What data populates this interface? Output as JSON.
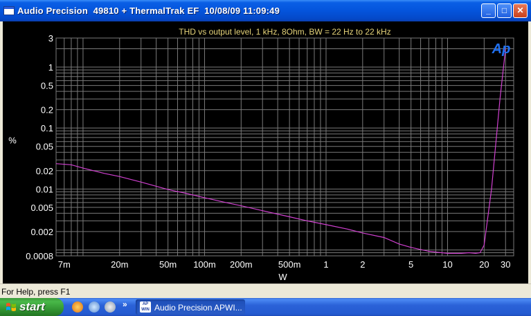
{
  "window": {
    "title": "Audio Precision  49810 + ThermalTrak EF  10/08/09 11:09:49",
    "minimize_glyph": "_",
    "maximize_glyph": "□",
    "close_glyph": "✕"
  },
  "status_bar": {
    "text": "For Help, press F1"
  },
  "taskbar": {
    "start_label": "start",
    "task_label": "Audio Precision APWI...",
    "task_icon_text": "AP WIN",
    "chevron": "»"
  },
  "colors": {
    "title_text": "#e6d47a",
    "trace": "#d040d0",
    "grid": "#7a7a7a",
    "tick_text": "#ffffff",
    "logo": "#2070f0"
  },
  "chart_data": {
    "type": "line",
    "title": "THD vs output level, 1 kHz, 8Ohm, BW = 22 Hz to 22 kHz",
    "xlabel": "W",
    "ylabel": "%",
    "x_scale": "log",
    "y_scale": "log",
    "xlim": [
      0.006,
      35
    ],
    "ylim": [
      0.0008,
      3
    ],
    "grid": true,
    "logo": "Ap",
    "x_ticks": [
      {
        "v": 0.007,
        "label": "7m"
      },
      {
        "v": 0.02,
        "label": "20m"
      },
      {
        "v": 0.05,
        "label": "50m"
      },
      {
        "v": 0.1,
        "label": "100m"
      },
      {
        "v": 0.2,
        "label": "200m"
      },
      {
        "v": 0.5,
        "label": "500m"
      },
      {
        "v": 1,
        "label": "1"
      },
      {
        "v": 2,
        "label": "2"
      },
      {
        "v": 5,
        "label": "5"
      },
      {
        "v": 10,
        "label": "10"
      },
      {
        "v": 20,
        "label": "20"
      },
      {
        "v": 30,
        "label": "30"
      }
    ],
    "y_ticks": [
      {
        "v": 3,
        "label": "3"
      },
      {
        "v": 1,
        "label": "1"
      },
      {
        "v": 0.5,
        "label": "0.5"
      },
      {
        "v": 0.2,
        "label": "0.2"
      },
      {
        "v": 0.1,
        "label": "0.1"
      },
      {
        "v": 0.05,
        "label": "0.05"
      },
      {
        "v": 0.02,
        "label": "0.02"
      },
      {
        "v": 0.01,
        "label": "0.01"
      },
      {
        "v": 0.005,
        "label": "0.005"
      },
      {
        "v": 0.002,
        "label": "0.002"
      },
      {
        "v": 0.0008,
        "label": "0.0008"
      }
    ],
    "series": [
      {
        "x": [
          0.006,
          0.008,
          0.01,
          0.015,
          0.02,
          0.03,
          0.05,
          0.07,
          0.1,
          0.15,
          0.2,
          0.3,
          0.5,
          0.7,
          1,
          1.5,
          2,
          3,
          4,
          5,
          7,
          10,
          13,
          15,
          17,
          18.5,
          20,
          23,
          27,
          30
        ],
        "y": [
          0.026,
          0.025,
          0.022,
          0.018,
          0.016,
          0.013,
          0.0098,
          0.0085,
          0.0072,
          0.006,
          0.0053,
          0.0044,
          0.0035,
          0.003,
          0.0026,
          0.0022,
          0.0019,
          0.0016,
          0.00125,
          0.0011,
          0.00095,
          0.00088,
          0.00088,
          0.0009,
          0.00088,
          0.0009,
          0.0012,
          0.01,
          0.3,
          2.0
        ]
      }
    ]
  }
}
